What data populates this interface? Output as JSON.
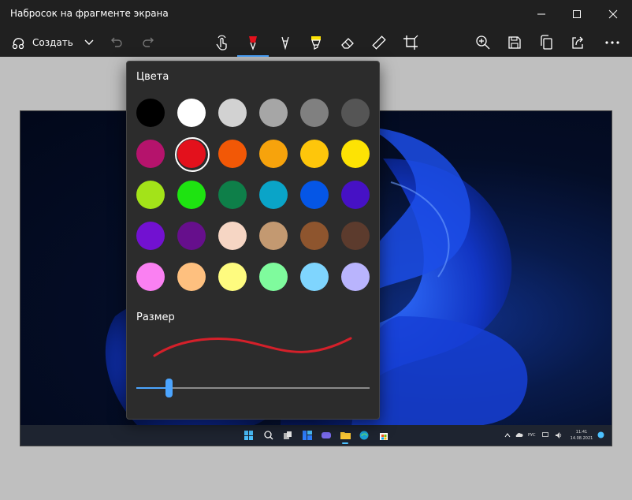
{
  "window": {
    "title": "Набросок на фрагменте экрана"
  },
  "toolbar": {
    "create_label": "Создать",
    "accent": "#4ca5ff"
  },
  "palette": {
    "heading": "Цвета",
    "selected_index": 7,
    "colors": [
      "#000000",
      "#ffffff",
      "#d2d2d2",
      "#a6a6a6",
      "#808080",
      "#555555",
      "#b5136c",
      "#e3111c",
      "#f25806",
      "#f7a30c",
      "#fec60b",
      "#fde304",
      "#a3e319",
      "#1ee311",
      "#0e7f49",
      "#0aa4c8",
      "#0556e6",
      "#4611c5",
      "#7211d1",
      "#660f8c",
      "#f6d6c4",
      "#c39971",
      "#8e552e",
      "#5c3b2d",
      "#fa80f2",
      "#fec07f",
      "#fefb7f",
      "#7ffb9d",
      "#7fd5fe",
      "#b9b4fd"
    ]
  },
  "size": {
    "heading": "Размер",
    "stroke_color": "#d4202a",
    "slider_fraction": 0.14
  },
  "taskbar": {
    "lang": "РУС",
    "time": "11:41",
    "date": "14.08.2021"
  }
}
